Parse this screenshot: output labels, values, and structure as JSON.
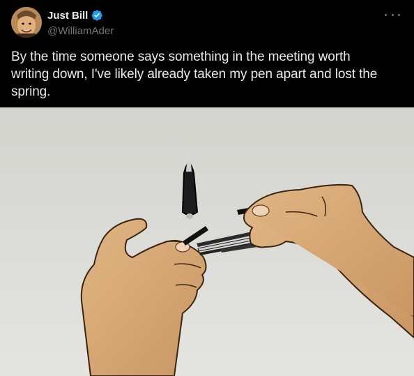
{
  "author": {
    "display_name": "Just Bill",
    "handle": "@WilliamAder",
    "avatar": "avatar-photo",
    "verified_icon": "verified-badge-icon",
    "verified_color": "#1d9bf0"
  },
  "menu_icon": "more-horizontal-icon",
  "tweet": {
    "text": "By the time someone says something in the meeting worth\nwriting down, I've likely already taken my pen apart and lost the\nspring."
  },
  "media": {
    "kind": "image"
  },
  "colors": {
    "background": "#000000",
    "text": "#e7e9ea",
    "secondary_text": "#71767b"
  }
}
